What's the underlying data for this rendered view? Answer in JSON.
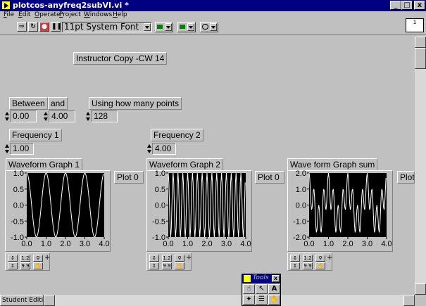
{
  "window": {
    "title": "plotcos-anyfreq2subVI.vi *",
    "controls": [
      "_",
      "□",
      "x"
    ]
  },
  "menubar": [
    "File",
    "Edit",
    "Operate",
    "Project",
    "Windows",
    "Help"
  ],
  "toolbar": {
    "font": "11pt System Font"
  },
  "panel": {
    "heading": "Instructor Copy -CW 14",
    "between_label": "Between",
    "and_label": "and",
    "points_label": "Using how many points",
    "between_value": "0.00",
    "and_value": "4.00",
    "points_value": "128",
    "freq1_label": "Frequency 1",
    "freq1_value": "1.00",
    "freq2_label": "Frequency 2",
    "freq2_value": "4.00"
  },
  "graphs": [
    {
      "title": "Waveform Graph 1",
      "legend": "Plot 0"
    },
    {
      "title": "Waveform Graph 2",
      "legend": "Plot 0"
    },
    {
      "title": "Wave form Graph sum",
      "legend": "Plot"
    }
  ],
  "status": {
    "edition": "Student Edition"
  },
  "tools": {
    "title": "Tools"
  },
  "chart_data": [
    {
      "type": "line",
      "title": "Waveform Graph 1",
      "xlim": [
        0,
        4
      ],
      "ylim": [
        -1,
        1
      ],
      "x_ticks": [
        "0.0",
        "1.0",
        "2.0",
        "3.0",
        "4.0"
      ],
      "y_ticks": [
        "1.0",
        "0.5",
        "0.0",
        "-0.5",
        "-1.0"
      ],
      "series": [
        {
          "name": "Plot 0",
          "function": "cos(2*pi*1.0*x)",
          "frequency": 1.0,
          "x_start": 0,
          "x_end": 4,
          "points": 128
        }
      ],
      "colors": {
        "background": "#000000",
        "line": "#ffffff"
      }
    },
    {
      "type": "line",
      "title": "Waveform Graph 2",
      "xlim": [
        0,
        4
      ],
      "ylim": [
        -1,
        1
      ],
      "x_ticks": [
        "0.0",
        "1.0",
        "2.0",
        "3.0",
        "4.0"
      ],
      "y_ticks": [
        "1.0",
        "0.5",
        "0.0",
        "-0.5",
        "-1.0"
      ],
      "series": [
        {
          "name": "Plot 0",
          "function": "cos(2*pi*4.0*x)",
          "frequency": 4.0,
          "x_start": 0,
          "x_end": 4,
          "points": 128
        }
      ],
      "colors": {
        "background": "#000000",
        "line": "#ffffff"
      }
    },
    {
      "type": "line",
      "title": "Wave form Graph sum",
      "xlim": [
        0,
        4
      ],
      "ylim": [
        -2,
        2
      ],
      "x_ticks": [
        "0.0",
        "1.0",
        "2.0",
        "3.0",
        "4.0"
      ],
      "y_ticks": [
        "2.0",
        "1.0",
        "0.0",
        "-1.0",
        "-2.0"
      ],
      "series": [
        {
          "function": "cos(2*pi*1.0*x)+cos(2*pi*4.0*x)",
          "frequencies": [
            1.0,
            4.0
          ],
          "x_start": 0,
          "x_end": 4,
          "points": 128
        }
      ],
      "colors": {
        "background": "#000000",
        "line": "#ffffff"
      }
    }
  ]
}
